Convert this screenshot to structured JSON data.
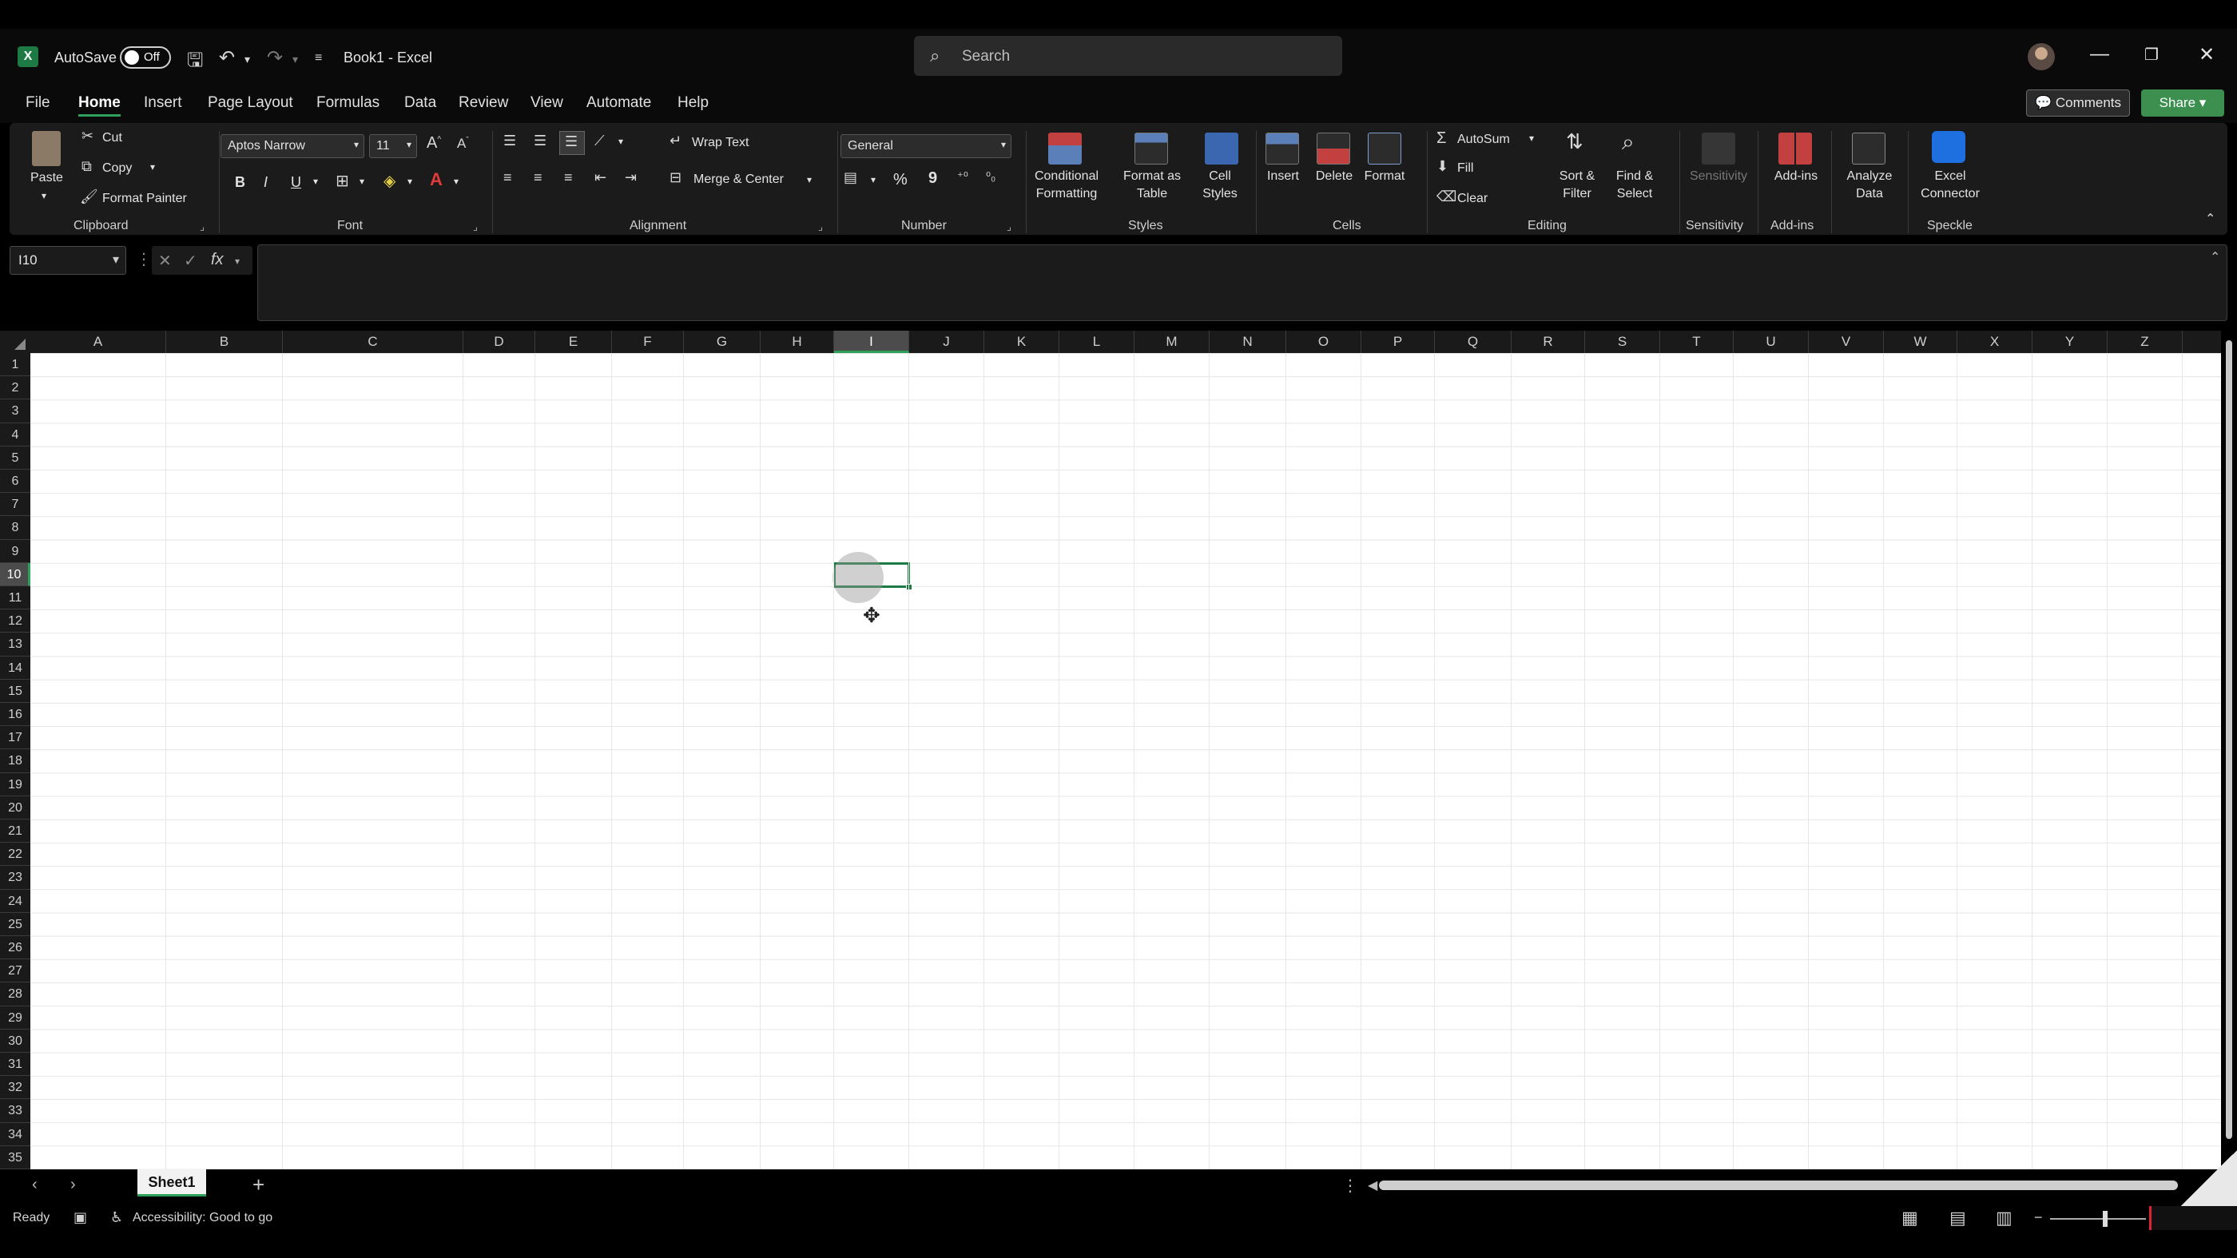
{
  "titlebar": {
    "autosave_label": "AutoSave",
    "autosave_state": "Off",
    "doc_title": "Book1 - Excel",
    "search_placeholder": "Search",
    "icons": [
      "excel-logo-icon",
      "save-icon",
      "undo-icon",
      "redo-icon",
      "customize-qat-icon",
      "search-icon",
      "account-avatar",
      "minimize-icon",
      "restore-icon",
      "close-icon"
    ]
  },
  "menu": {
    "tabs": [
      "File",
      "Home",
      "Insert",
      "Page Layout",
      "Formulas",
      "Data",
      "Review",
      "View",
      "Automate",
      "Help"
    ],
    "active": "Home",
    "comments_label": "Comments",
    "share_label": "Share"
  },
  "ribbon": {
    "clipboard": {
      "paste": "Paste",
      "cut": "Cut",
      "copy": "Copy",
      "format_painter": "Format Painter",
      "label": "Clipboard"
    },
    "font": {
      "name": "Aptos Narrow",
      "size": "11",
      "label": "Font",
      "bold": "B",
      "italic": "I",
      "underline": "U"
    },
    "alignment": {
      "wrap_text": "Wrap Text",
      "merge_center": "Merge & Center",
      "label": "Alignment"
    },
    "number": {
      "format": "General",
      "label": "Number",
      "percent": "%",
      "comma": "9"
    },
    "styles": {
      "conditional_formatting": [
        "Conditional",
        "Formatting"
      ],
      "format_as_table": [
        "Format as",
        "Table"
      ],
      "cell_styles": [
        "Cell",
        "Styles"
      ],
      "label": "Styles"
    },
    "cells": {
      "insert": "Insert",
      "delete": "Delete",
      "format": "Format",
      "label": "Cells"
    },
    "editing": {
      "autosum": "AutoSum",
      "fill": "Fill",
      "clear": "Clear",
      "sort_filter": [
        "Sort &",
        "Filter"
      ],
      "find_select": [
        "Find &",
        "Select"
      ],
      "label": "Editing"
    },
    "sensitivity": {
      "button": "Sensitivity",
      "label": "Sensitivity"
    },
    "addins": {
      "button": "Add-ins",
      "label": "Add-ins"
    },
    "analyze": {
      "button": [
        "Analyze",
        "Data"
      ]
    },
    "speckle": {
      "button": [
        "Excel",
        "Connector"
      ],
      "label": "Speckle"
    }
  },
  "formula_bar": {
    "name_box": "I10",
    "fx": "fx",
    "value": ""
  },
  "grid": {
    "columns": [
      "A",
      "B",
      "C",
      "D",
      "E",
      "F",
      "G",
      "H",
      "I",
      "J",
      "K",
      "L",
      "M",
      "N",
      "O",
      "P",
      "Q",
      "R",
      "S",
      "T",
      "U",
      "V",
      "W",
      "X",
      "Y",
      "Z"
    ],
    "rows": [
      "1",
      "2",
      "3",
      "4",
      "5",
      "6",
      "7",
      "8",
      "9",
      "10",
      "11",
      "12",
      "13",
      "14",
      "15",
      "16",
      "17",
      "18",
      "19",
      "20",
      "21",
      "22",
      "23",
      "24",
      "25",
      "26",
      "27",
      "28",
      "29",
      "30",
      "31",
      "32",
      "33",
      "34",
      "35"
    ],
    "selected_column": "I",
    "selected_row": "10"
  },
  "sheets": {
    "tabs": [
      "Sheet1"
    ],
    "active": "Sheet1",
    "add_label": "+"
  },
  "status": {
    "ready": "Ready",
    "accessibility": "Accessibility: Good to go"
  },
  "colors": {
    "accent": "#1d7a45",
    "share": "#3c8f4e",
    "background": "#000000"
  }
}
